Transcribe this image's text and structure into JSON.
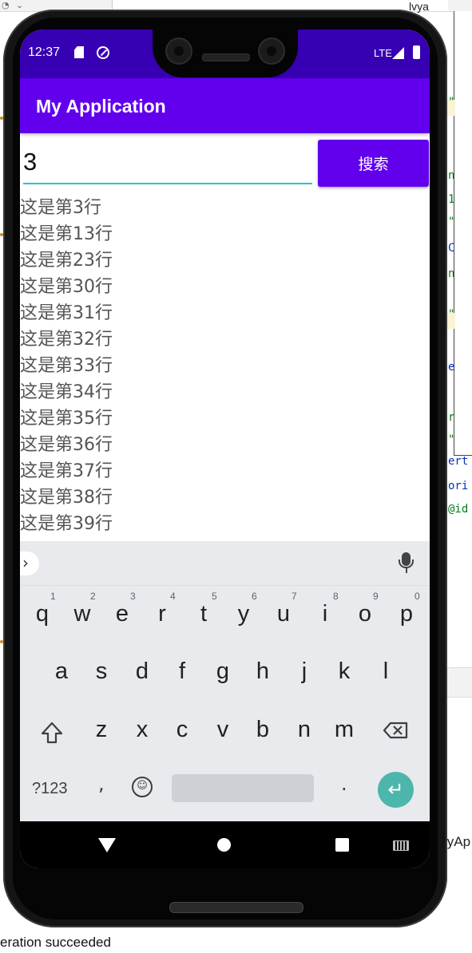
{
  "ide": {
    "tab_fragment": "lvya",
    "status_text": "eration succeeded",
    "right_fragment": "lyAp",
    "code_lines": [
      {
        "text": "\"",
        "color": "#067d17"
      },
      {
        "text": "n",
        "color": "#067d17"
      },
      {
        "text": "1",
        "color": "#067d17"
      },
      {
        "text": "\"",
        "color": "#067d17"
      },
      {
        "text": "C",
        "color": "#0033b3"
      },
      {
        "text": "n",
        "color": "#067d17"
      },
      {
        "text": "\"",
        "color": "#067d17"
      },
      {
        "text": "e",
        "color": "#0033b3"
      },
      {
        "text": "r",
        "color": "#067d17"
      },
      {
        "text": "\"",
        "color": "#067d17"
      },
      {
        "text": "ert",
        "color": "#0033b3"
      },
      {
        "text": "ori",
        "color": "#0033b3"
      },
      {
        "text": "@id",
        "color": "#067d17"
      }
    ]
  },
  "device": {
    "status_bar": {
      "time": "12:37",
      "network": "LTE"
    },
    "app": {
      "title": "My Application",
      "search": {
        "value": "3",
        "button_label": "搜索"
      },
      "results": [
        "这是第3行",
        "这是第13行",
        "这是第23行",
        "这是第30行",
        "这是第31行",
        "这是第32行",
        "这是第33行",
        "这是第34行",
        "这是第35行",
        "这是第36行",
        "这是第37行",
        "这是第38行",
        "这是第39行"
      ]
    },
    "keyboard": {
      "row1": [
        {
          "key": "q",
          "hint": "1"
        },
        {
          "key": "w",
          "hint": "2"
        },
        {
          "key": "e",
          "hint": "3"
        },
        {
          "key": "r",
          "hint": "4"
        },
        {
          "key": "t",
          "hint": "5"
        },
        {
          "key": "y",
          "hint": "6"
        },
        {
          "key": "u",
          "hint": "7"
        },
        {
          "key": "i",
          "hint": "8"
        },
        {
          "key": "o",
          "hint": "9"
        },
        {
          "key": "p",
          "hint": "0"
        }
      ],
      "row2": [
        "a",
        "s",
        "d",
        "f",
        "g",
        "h",
        "j",
        "k",
        "l"
      ],
      "row3": [
        "z",
        "x",
        "c",
        "v",
        "b",
        "n",
        "m"
      ],
      "symbols_label": "?123",
      "comma": ",",
      "period": ".",
      "expand_glyph": "›",
      "enter_glyph": "↵",
      "emoji_glyph": "☺"
    },
    "colors": {
      "status_bar": "#3700b3",
      "app_bar": "#6200ee",
      "accent_underline": "#26c6c6",
      "enter_key": "#4db6ac"
    },
    "icons": [
      "sd-card-icon",
      "data-saver-icon",
      "signal-icon",
      "battery-icon",
      "mic-icon",
      "shift-icon",
      "backspace-icon",
      "back-icon",
      "home-icon",
      "recents-icon",
      "keyboard-switch-icon"
    ]
  }
}
